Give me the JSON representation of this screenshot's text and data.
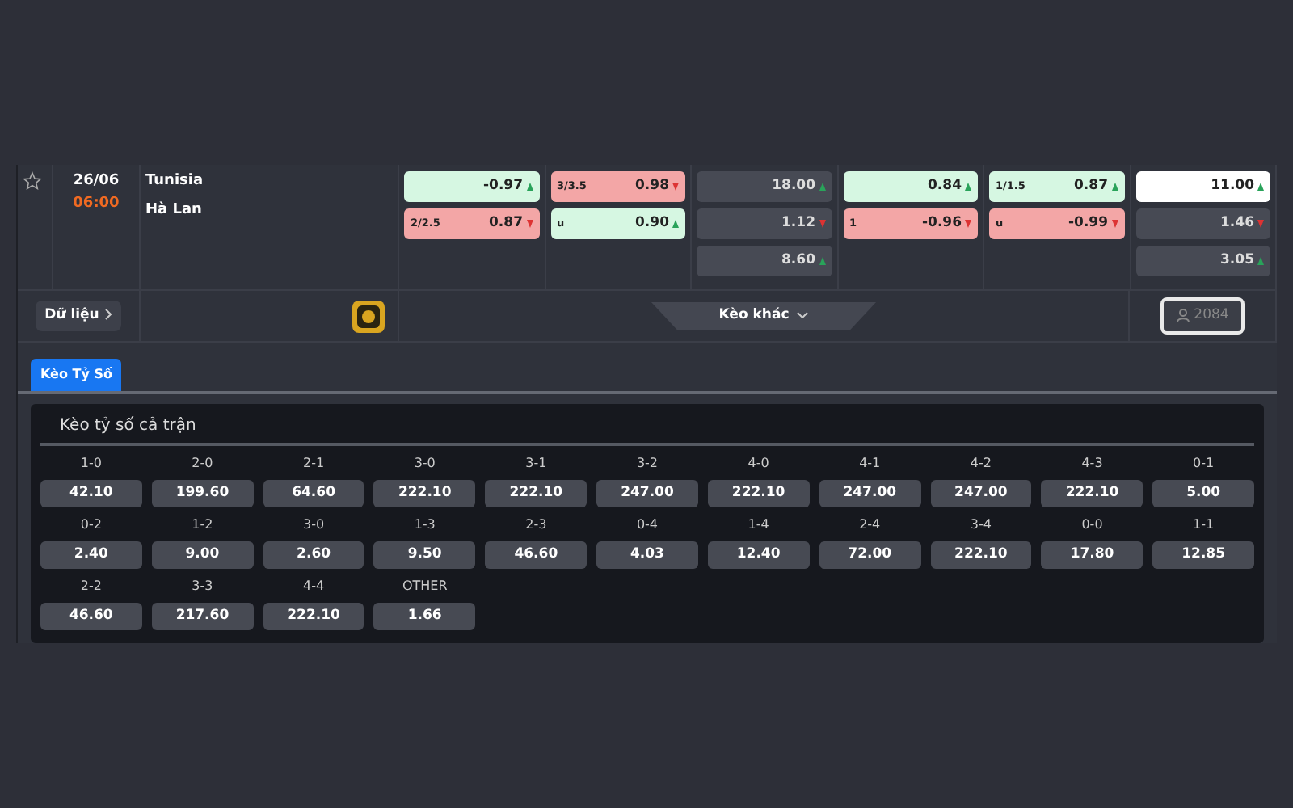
{
  "match": {
    "starred": false,
    "date": "26/06",
    "time": "06:00",
    "home": "Tunisia",
    "away": "Hà Lan",
    "odds_columns": [
      [
        {
          "kind": "green",
          "value": "-0.97",
          "rising": true
        },
        {
          "kind": "red",
          "label": "2/2.5",
          "value": "0.87",
          "rising": false
        }
      ],
      [
        {
          "kind": "red",
          "label": "3/3.5",
          "value": "0.98",
          "rising": false
        },
        {
          "kind": "green",
          "label": "u",
          "value": "0.90",
          "rising": true
        }
      ],
      [
        {
          "kind": "grey",
          "value": "18.00",
          "rising": true
        },
        {
          "kind": "grey",
          "value": "1.12",
          "rising": false
        },
        {
          "kind": "grey",
          "value": "8.60",
          "rising": true
        }
      ],
      [
        {
          "kind": "green",
          "value": "0.84",
          "rising": true
        },
        {
          "kind": "red",
          "label": "1",
          "value": "-0.96",
          "rising": false
        }
      ],
      [
        {
          "kind": "green",
          "label": "1/1.5",
          "value": "0.87",
          "rising": true
        },
        {
          "kind": "red",
          "label": "u",
          "value": "-0.99",
          "rising": false
        }
      ],
      [
        {
          "kind": "white",
          "value": "11.00",
          "rising": true
        },
        {
          "kind": "grey",
          "value": "1.46",
          "rising": false
        },
        {
          "kind": "grey",
          "value": "3.05",
          "rising": true
        }
      ]
    ],
    "data_button": "Dữ liệu",
    "more_button": "Kèo khác",
    "viewers": "2084",
    "viewers_disabled": true
  },
  "tabs": [
    {
      "label": "Kèo Tỷ Số",
      "selected": true
    }
  ],
  "score_panel": {
    "title": "Kèo tỷ số cả trận",
    "scores": [
      {
        "score": "1-0",
        "odds": "42.10"
      },
      {
        "score": "2-0",
        "odds": "199.60"
      },
      {
        "score": "2-1",
        "odds": "64.60"
      },
      {
        "score": "3-0",
        "odds": "222.10"
      },
      {
        "score": "3-1",
        "odds": "222.10"
      },
      {
        "score": "3-2",
        "odds": "247.00"
      },
      {
        "score": "4-0",
        "odds": "222.10"
      },
      {
        "score": "4-1",
        "odds": "247.00"
      },
      {
        "score": "4-2",
        "odds": "247.00"
      },
      {
        "score": "4-3",
        "odds": "222.10"
      },
      {
        "score": "0-1",
        "odds": "5.00"
      },
      {
        "score": "0-2",
        "odds": "2.40"
      },
      {
        "score": "1-2",
        "odds": "9.00"
      },
      {
        "score": "3-0",
        "odds": "2.60"
      },
      {
        "score": "1-3",
        "odds": "9.50"
      },
      {
        "score": "2-3",
        "odds": "46.60"
      },
      {
        "score": "0-4",
        "odds": "4.03"
      },
      {
        "score": "1-4",
        "odds": "12.40"
      },
      {
        "score": "2-4",
        "odds": "72.00"
      },
      {
        "score": "3-4",
        "odds": "222.10"
      },
      {
        "score": "0-0",
        "odds": "17.80"
      },
      {
        "score": "1-1",
        "odds": "12.85"
      },
      {
        "score": "2-2",
        "odds": "46.60"
      },
      {
        "score": "3-3",
        "odds": "217.60"
      },
      {
        "score": "4-4",
        "odds": "222.10"
      },
      {
        "score": "OTHER",
        "odds": "1.66"
      }
    ]
  }
}
